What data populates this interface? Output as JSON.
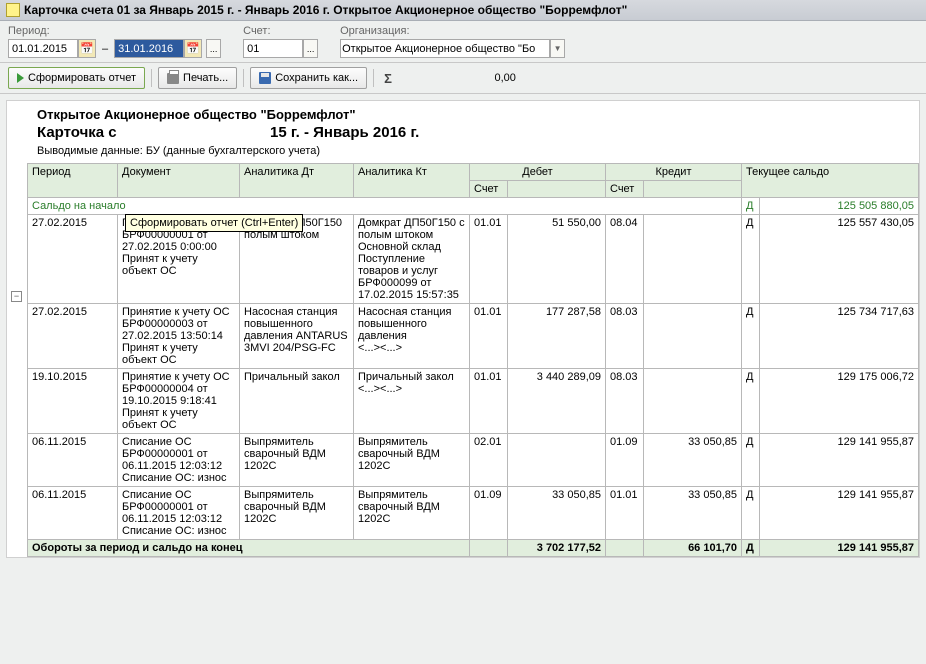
{
  "window": {
    "title": "Карточка счета 01 за Январь 2015 г. - Январь 2016 г. Открытое Акционерное общество \"Борремфлот\""
  },
  "filters": {
    "period_label": "Период:",
    "date_from": "01.01.2015",
    "date_to": "31.01.2016",
    "dash": "–",
    "account_label": "Счет:",
    "account": "01",
    "org_label": "Организация:",
    "org_value": "Открытое Акционерное общество \"Бо"
  },
  "toolbar": {
    "form_report": "Сформировать отчет",
    "print": "Печать...",
    "save_as": "Сохранить как...",
    "total": "0,00"
  },
  "tooltip": "Сформировать отчет (Ctrl+Enter)",
  "report": {
    "org": "Открытое Акционерное общество \"Борремфлот\"",
    "title_partial_left": "Карточка с",
    "title_partial_right": "15 г. - Январь 2016 г.",
    "subtitle": "Выводимые данные:   БУ (данные бухгалтерского учета)"
  },
  "headers": {
    "period": "Период",
    "document": "Документ",
    "an_dt": "Аналитика Дт",
    "an_kt": "Аналитика Кт",
    "debit": "Дебет",
    "credit": "Кредит",
    "balance": "Текущее сальдо",
    "acct": "Счет"
  },
  "start_balance": {
    "label": "Сальдо на начало",
    "dk": "Д",
    "amount": "125 505 880,05"
  },
  "rows": [
    {
      "period": "27.02.2015",
      "doc": "Принятие к учету ОС БРФ00000001 от 27.02.2015 0:00:00\nПринят к учету объект ОС",
      "an_dt": "Домкрат ДП50Г150 полым штоком",
      "an_kt": "Домкрат ДП50Г150 с полым штоком\nОсновной склад\nПоступление товаров и услуг БРФ000099 от 17.02.2015 15:57:35",
      "d_acct": "01.01",
      "d_amt": "51 550,00",
      "c_acct": "08.04",
      "c_amt": "",
      "dk": "Д",
      "bal": "125 557 430,05"
    },
    {
      "period": "27.02.2015",
      "doc": "Принятие к учету ОС БРФ00000003 от 27.02.2015 13:50:14\nПринят к учету объект ОС",
      "an_dt": "Насосная станция повышенного давления ANTARUS 3MVI 204/PSG-FC",
      "an_kt": "Насосная станция повышенного давления\n<...><...>",
      "d_acct": "01.01",
      "d_amt": "177 287,58",
      "c_acct": "08.03",
      "c_amt": "",
      "dk": "Д",
      "bal": "125 734 717,63"
    },
    {
      "period": "19.10.2015",
      "doc": "Принятие к учету ОС БРФ00000004 от 19.10.2015 9:18:41\nПринят к учету объект ОС",
      "an_dt": "Причальный закол",
      "an_kt": "Причальный закол\n<...><...>",
      "d_acct": "01.01",
      "d_amt": "3 440 289,09",
      "c_acct": "08.03",
      "c_amt": "",
      "dk": "Д",
      "bal": "129 175 006,72"
    },
    {
      "period": "06.11.2015",
      "doc": "Списание ОС БРФ00000001 от 06.11.2015 12:03:12\nСписание ОС: износ",
      "an_dt": "Выпрямитель сварочный ВДМ 1202С",
      "an_kt": "Выпрямитель сварочный ВДМ 1202С",
      "d_acct": "02.01",
      "d_amt": "",
      "c_acct": "01.09",
      "c_amt": "33 050,85",
      "dk": "Д",
      "bal": "129 141 955,87"
    },
    {
      "period": "06.11.2015",
      "doc": "Списание ОС БРФ00000001 от 06.11.2015 12:03:12\nСписание ОС: износ",
      "an_dt": "Выпрямитель сварочный ВДМ 1202С",
      "an_kt": "Выпрямитель сварочный ВДМ 1202С",
      "d_acct": "01.09",
      "d_amt": "33 050,85",
      "c_acct": "01.01",
      "c_amt": "33 050,85",
      "dk": "Д",
      "bal": "129 141 955,87"
    }
  ],
  "totals": {
    "label": "Обороты за период и сальдо на конец",
    "d_total": "3 702 177,52",
    "c_total": "66 101,70",
    "dk": "Д",
    "bal": "129 141 955,87"
  }
}
